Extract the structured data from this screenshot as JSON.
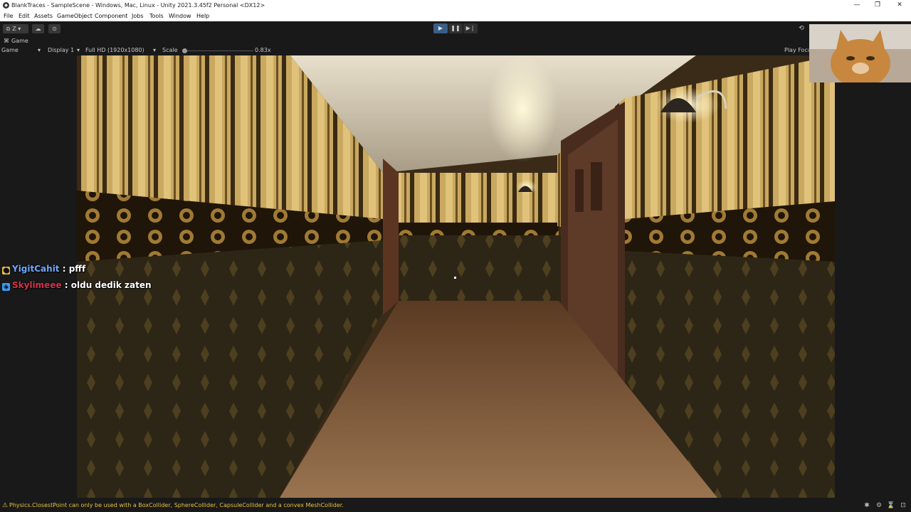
{
  "window": {
    "title": "BlankTraces - SampleScene - Windows, Mac, Linux - Unity 2021.3.45f2 Personal <DX12>",
    "minimize": "—",
    "maximize": "❐",
    "close": "✕"
  },
  "menu": [
    "File",
    "Edit",
    "Assets",
    "GameObject",
    "Component",
    "Jobs",
    "Tools",
    "Window",
    "Help"
  ],
  "toolbar": {
    "account_label": "Z",
    "cloud_icon": "☁",
    "collab_icon": "⊙",
    "play_icon": "▶",
    "pause_icon": "❚❚",
    "step_icon": "▶❘",
    "history_icon": "⟲"
  },
  "game_tab": {
    "tab_label": "Game",
    "view_dropdown": "Game",
    "display": "Display 1",
    "resolution": "Full HD (1920x1080)",
    "scale_label": "Scale",
    "scale_value": "0.83x",
    "scale_fraction": 0.02,
    "play_focused": "Play Focu"
  },
  "chat": [
    {
      "user": "YigitCahit",
      "message": ": pfff",
      "user_color": "#6fa8ff",
      "badge_color": "#f2c94c"
    },
    {
      "user": "Skylimeee",
      "message": ": oldu dedik zaten",
      "user_color": "#d9304a",
      "badge_color": "#3d9df5"
    }
  ],
  "status": {
    "warning_icon": "⚠",
    "message": "Physics.ClosestPoint can only be used with a BoxCollider, SphereCollider, CapsuleCollider and a convex MeshCollider."
  },
  "colors": {
    "editor_bg": "#191919",
    "play_active": "#3a5e86",
    "warning": "#e8c23a"
  }
}
